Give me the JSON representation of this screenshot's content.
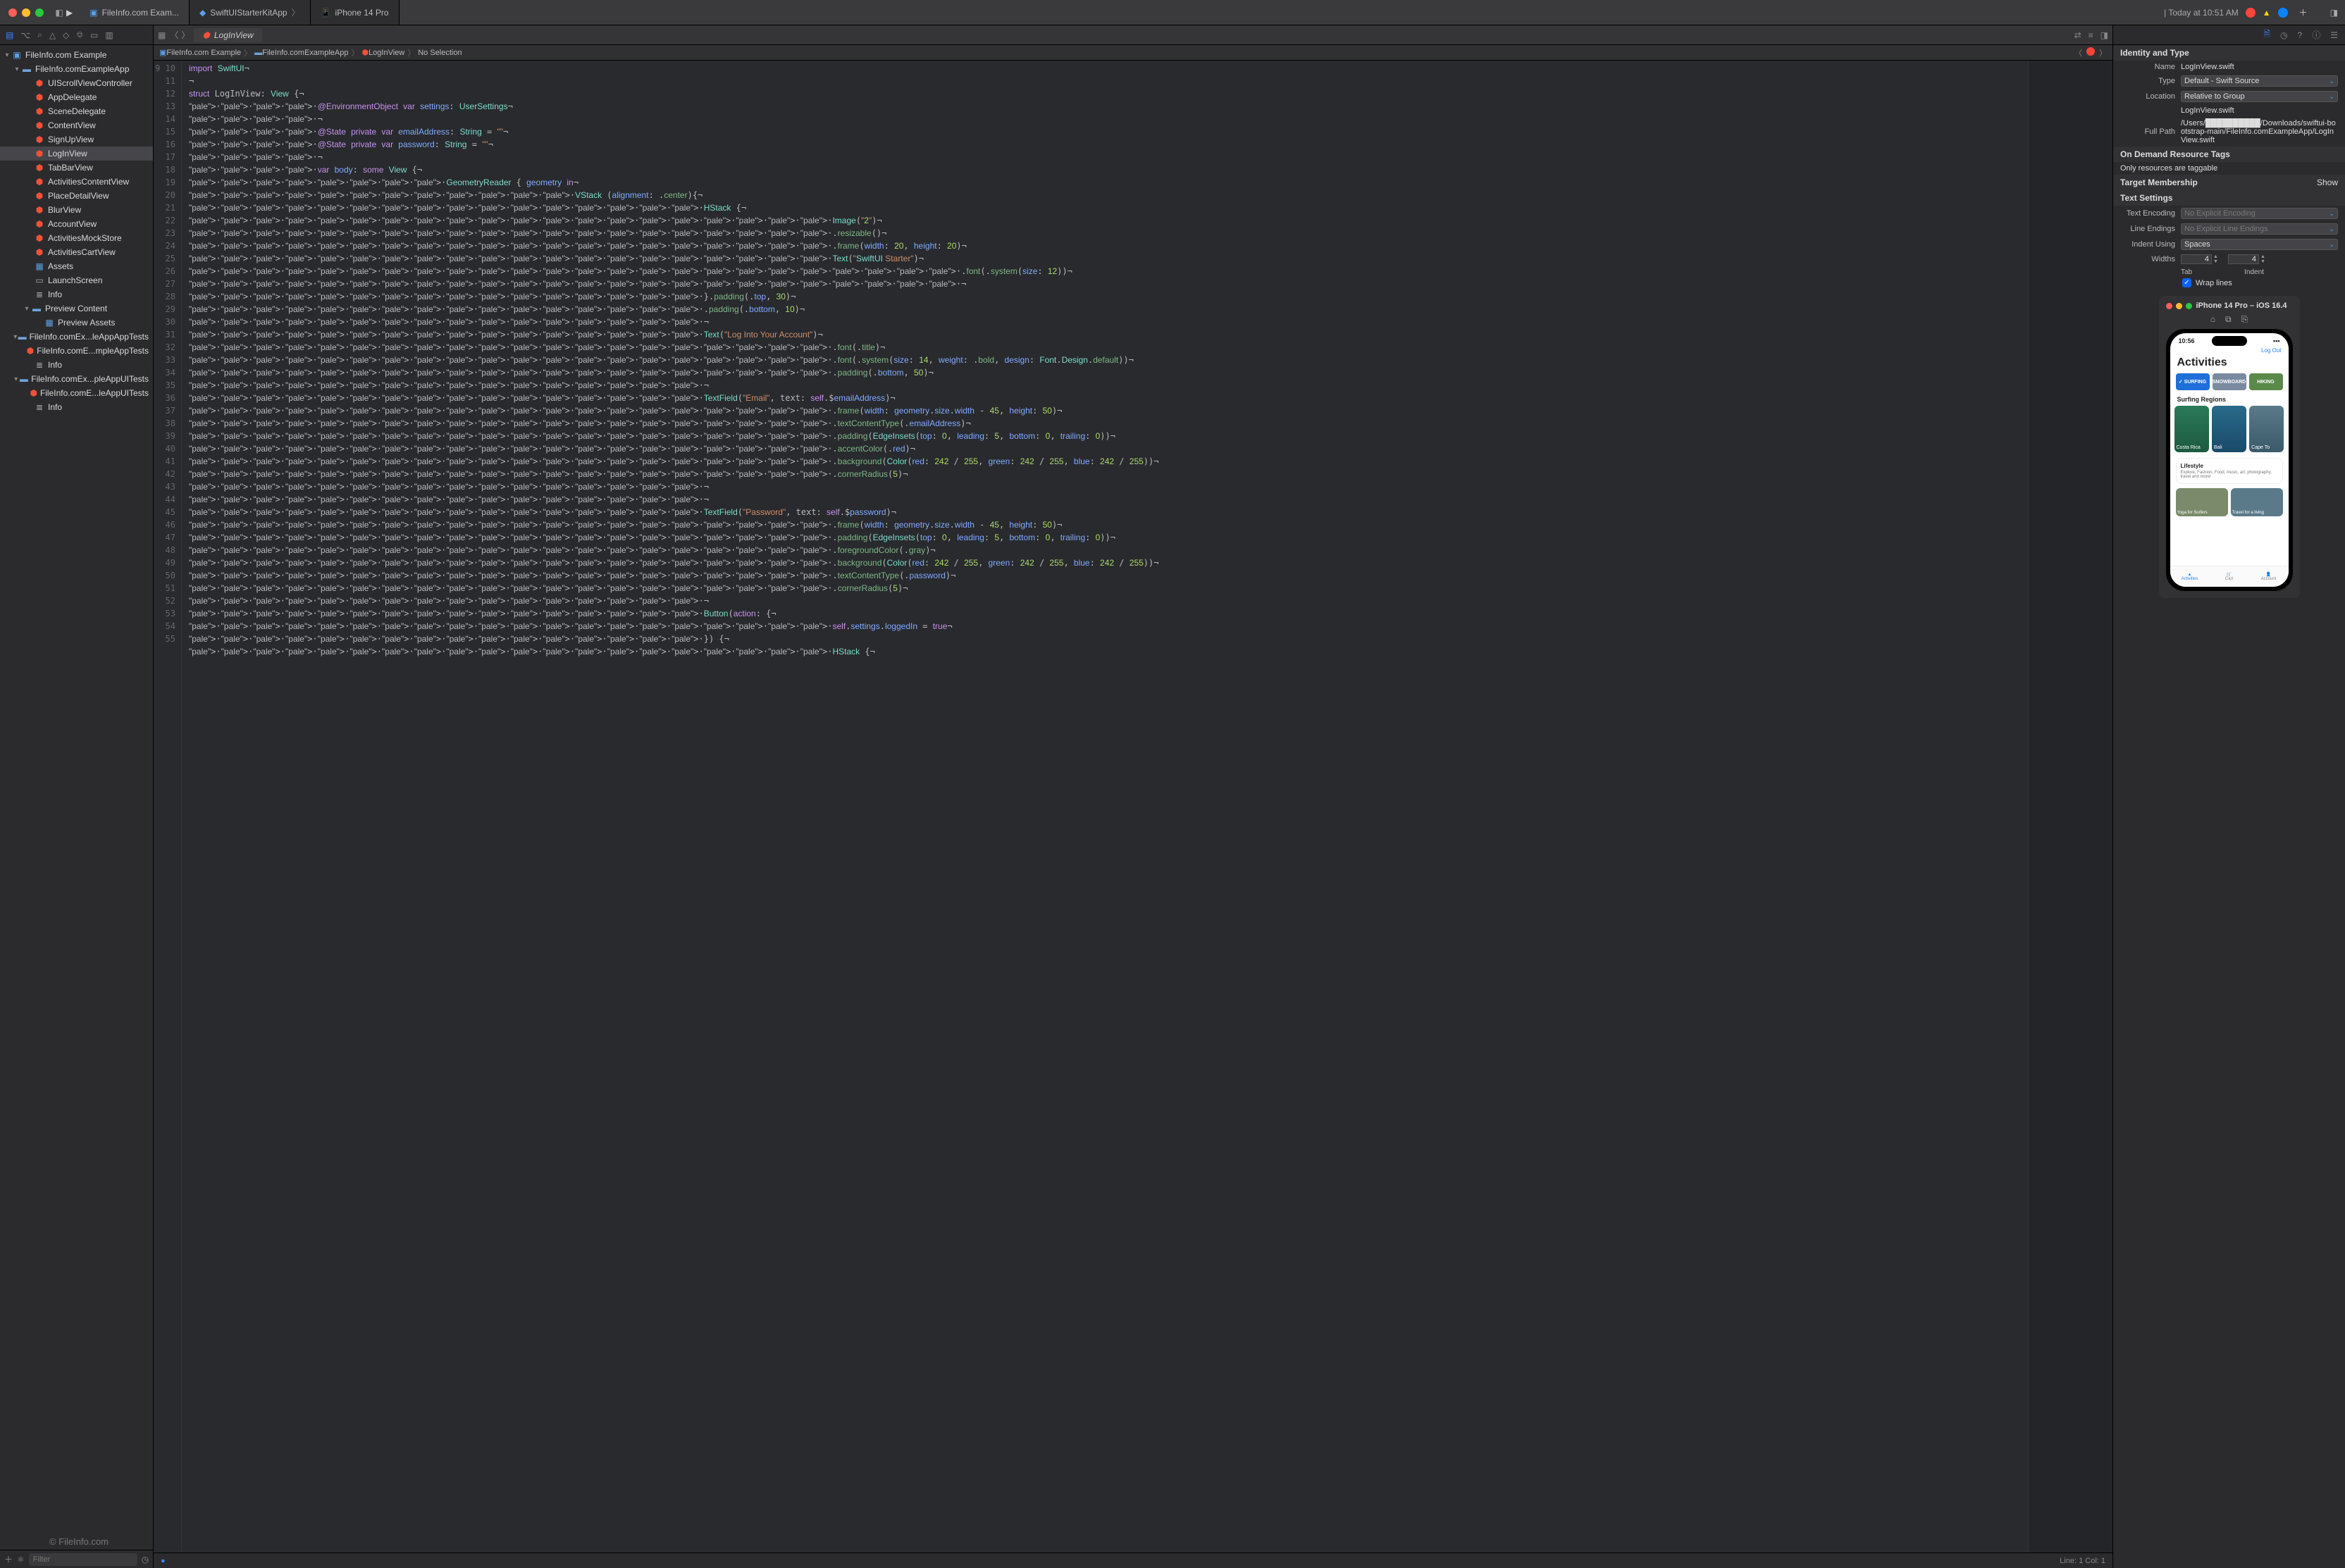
{
  "titlebar": {
    "tabs": [
      {
        "label": "FileInfo.com Exam...",
        "active": true
      },
      {
        "label": "SwiftUIStarterKitApp"
      },
      {
        "label": "iPhone 14 Pro"
      }
    ],
    "clock": "Today at 10:51 AM"
  },
  "nav_toolbar_icons": [
    "folder",
    "git",
    "magnify",
    "warn",
    "tag",
    "breakpoint",
    "box",
    "report"
  ],
  "project_tree": {
    "root": "FileInfo.com Example",
    "app_group": "FileInfo.comExampleApp",
    "swift_files": [
      "UIScrollViewController",
      "AppDelegate",
      "SceneDelegate",
      "ContentView",
      "SignUpView",
      "LogInView",
      "TabBarView",
      "ActivitiesContentView",
      "PlaceDetailView",
      "BlurView",
      "AccountView",
      "ActivitiesMockStore",
      "ActivitiesCartView"
    ],
    "assets": "Assets",
    "launchscreen": "LaunchScreen",
    "info": "Info",
    "preview_group": "Preview Content",
    "preview_assets": "Preview Assets",
    "tests_group": "FileInfo.comEx...leAppAppTests",
    "tests_file": "FileInfo.comE...mpleAppTests",
    "tests_info": "Info",
    "uitests_group": "FileInfo.comEx...pleAppUITests",
    "uitests_file": "FileInfo.comE...leAppUITests",
    "uitests_info": "Info",
    "selected": "LogInView"
  },
  "nav_filter_placeholder": "Filter",
  "editor": {
    "open_file": "LogInView",
    "jumpbar": [
      "FileInfo.com Example",
      "FileInfo.comExampleApp",
      "LogInView",
      "No Selection"
    ],
    "status": "Line: 1  Col: 1",
    "first_line_no": 9,
    "lines": [
      "import SwiftUI¬",
      "¬",
      "struct LogInView: View {¬",
      "····@EnvironmentObject var settings: UserSettings¬",
      "····¬",
      "····@State private var emailAddress: String = \"\"¬",
      "····@State private var password: String = \"\"¬",
      "····¬",
      "····var body: some View {¬",
      "········GeometryReader { geometry in¬",
      "············VStack (alignment: .center){¬",
      "················HStack {¬",
      "····················Image(\"2\")¬",
      "····················.resizable()¬",
      "····················.frame(width: 20, height: 20)¬",
      "····················Text(\"SwiftUI Starter\")¬",
      "························.font(.system(size: 12))¬",
      "························¬",
      "················}.padding(.top, 30)¬",
      "················.padding(.bottom, 10)¬",
      "················¬",
      "················Text(\"Log Into Your Account\")¬",
      "····················.font(.title)¬",
      "····················.font(.system(size: 14, weight: .bold, design: Font.Design.default))¬",
      "····················.padding(.bottom, 50)¬",
      "················¬",
      "················TextField(\"Email\", text: self.$emailAddress)¬",
      "····················.frame(width: geometry.size.width - 45, height: 50)¬",
      "····················.textContentType(.emailAddress)¬",
      "····················.padding(EdgeInsets(top: 0, leading: 5, bottom: 0, trailing: 0))¬",
      "····················.accentColor(.red)¬",
      "····················.background(Color(red: 242 / 255, green: 242 / 255, blue: 242 / 255))¬",
      "····················.cornerRadius(5)¬",
      "················¬",
      "················¬",
      "················TextField(\"Password\", text: self.$password)¬",
      "····················.frame(width: geometry.size.width - 45, height: 50)¬",
      "····················.padding(EdgeInsets(top: 0, leading: 5, bottom: 0, trailing: 0))¬",
      "····················.foregroundColor(.gray)¬",
      "····················.background(Color(red: 242 / 255, green: 242 / 255, blue: 242 / 255))¬",
      "····················.textContentType(.password)¬",
      "····················.cornerRadius(5)¬",
      "················¬",
      "················Button(action: {¬",
      "····················self.settings.loggedIn = true¬",
      "················}) {¬",
      "····················HStack {¬"
    ]
  },
  "inspector": {
    "section_identity": "Identity and Type",
    "name_label": "Name",
    "name_value": "LogInView.swift",
    "type_label": "Type",
    "type_value": "Default - Swift Source",
    "location_label": "Location",
    "location_value": "Relative to Group",
    "location_file": "LogInView.swift",
    "fullpath_label": "Full Path",
    "fullpath_value": "/Users/██████████/Downloads/swiftui-bootstrap-main/FileInfo.comExampleApp/LogInView.swift",
    "ondemand_title": "On Demand Resource Tags",
    "ondemand_hint": "Only resources are taggable",
    "target_title": "Target Membership",
    "target_show": "Show",
    "textsettings_title": "Text Settings",
    "encoding_label": "Text Encoding",
    "encoding_value": "No Explicit Encoding",
    "lineendings_label": "Line Endings",
    "lineendings_value": "No Explicit Line Endings",
    "indent_label": "Indent Using",
    "indent_value": "Spaces",
    "widths_label": "Widths",
    "tab_value": "4",
    "tab_label": "Tab",
    "indent_value2": "4",
    "indent_label2": "Indent",
    "wrap_label": "Wrap lines"
  },
  "simulator": {
    "title": "iPhone 14 Pro – iOS 16.4",
    "clock": "10:56",
    "logout": "Log Out",
    "heading": "Activities",
    "chips": [
      "✓ SURFING",
      "SNOWBOARD",
      "HIKING"
    ],
    "sub": "Surfing Regions",
    "regions": [
      "Costa Rica",
      "Bali",
      "Cape To"
    ],
    "card_title": "Lifestyle",
    "card_body": "Explore, Fashion, Food, music, art, photography, travel and more!",
    "wides": [
      "Yoga for Surfers",
      "Travel for a living"
    ],
    "tabs": [
      "Activities",
      "Cart",
      "Account"
    ]
  },
  "watermark": "© FileInfo.com"
}
